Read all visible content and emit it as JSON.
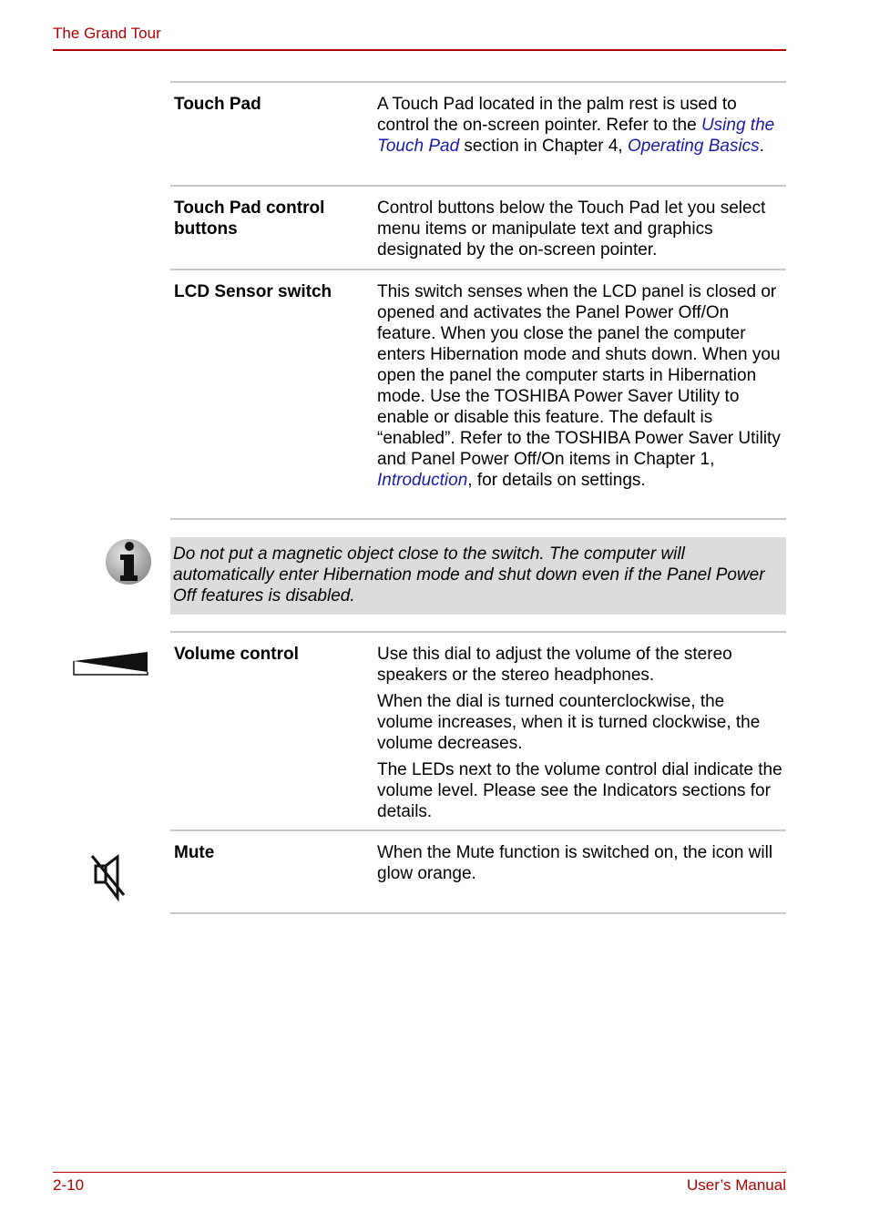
{
  "header": {
    "title": "The Grand Tour"
  },
  "footer": {
    "page_number": "2-10",
    "manual_title": "User’s Manual"
  },
  "rows": [
    {
      "term": "Touch Pad",
      "desc": [
        {
          "t": "A Touch Pad located in the palm rest is used to control the on-screen pointer. Refer to the "
        },
        {
          "link": "Using the Touch Pad"
        },
        {
          "t": " section in Chapter 4, "
        },
        {
          "link": "Operating Basics"
        },
        {
          "t": "."
        }
      ]
    },
    {
      "term": "Touch Pad control buttons",
      "desc_text": "Control buttons below the Touch Pad let you select menu items or manipulate text and graphics designated by the on-screen pointer."
    },
    {
      "term": "LCD Sensor switch",
      "desc_pre": "This switch senses when the LCD panel is closed or opened and activates the Panel Power Off/On feature. When you close the panel the computer enters Hibernation mode and shuts down. When you open the panel the computer starts in Hibernation mode. Use the TOSHIBA Power Saver Utility to enable or disable this feature. The default is “enabled”. Refer to the TOSHIBA Power Saver Utility and Panel Power Off/On items in Chapter 1, ",
      "desc_link": "Introduction",
      "desc_post": ", for details on settings."
    }
  ],
  "note": {
    "icon": "info-icon",
    "text": "Do not put a magnetic object close to the switch. The computer will automatically enter Hibernation mode and shut down even if the Panel Power Off features is disabled."
  },
  "rows2": [
    {
      "icon": "volume-wedge-icon",
      "term": "Volume control",
      "paras": [
        "Use this dial to adjust the volume of the stereo speakers or the stereo headphones.",
        "When the dial is turned counterclockwise, the volume increases, when it is turned clockwise, the volume decreases.",
        "The LEDs next to the volume control dial indicate the volume level. Please see the Indicators sections for details."
      ]
    },
    {
      "icon": "mute-speaker-icon",
      "term": "Mute",
      "paras": [
        "When the Mute function is switched on, the icon will glow orange."
      ]
    }
  ],
  "colors": {
    "accent": "#b00000",
    "link": "#1a1aa8",
    "note_bg": "#dcdcdc",
    "rule": "#c8c8c8"
  }
}
